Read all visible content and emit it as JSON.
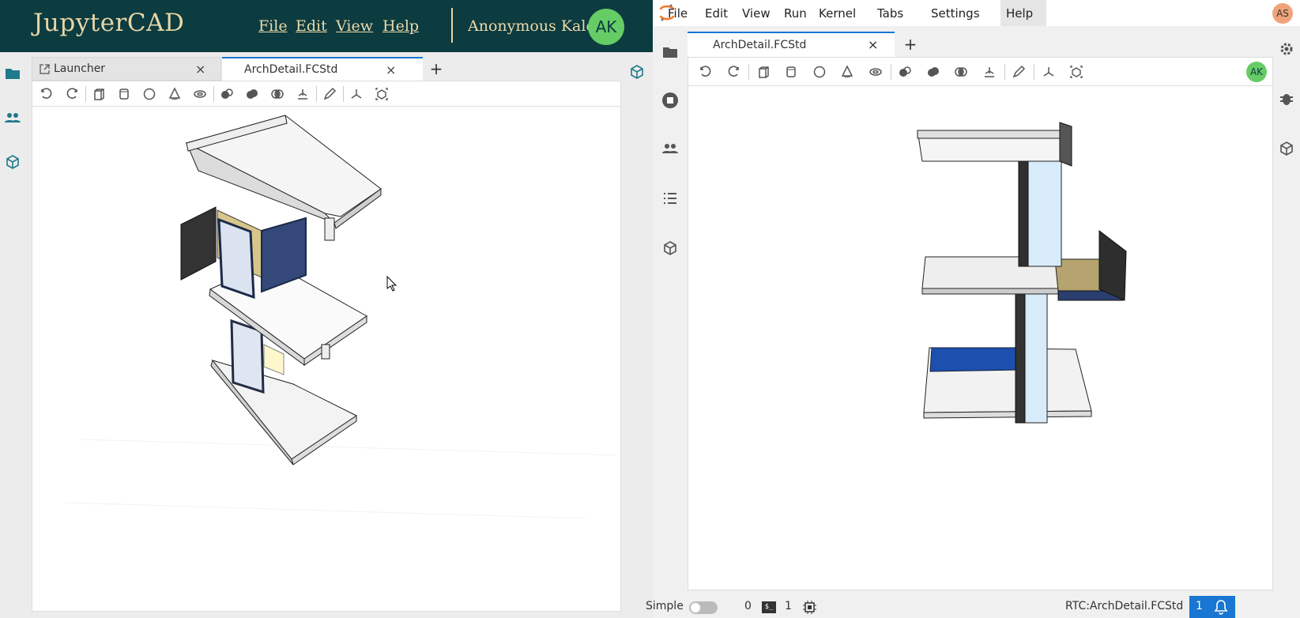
{
  "left_app": {
    "brand": "JupyterCAD",
    "menu": [
      "File",
      "Edit",
      "View",
      "Help"
    ],
    "user_name": "Anonymous Kale",
    "user_initials": "AK",
    "tabs": [
      {
        "label": "Launcher"
      },
      {
        "label": "ArchDetail.FCStd"
      }
    ]
  },
  "right_app": {
    "menu": [
      "File",
      "Edit",
      "View",
      "Run",
      "Kernel",
      "Tabs",
      "Settings",
      "Help"
    ],
    "user_initials": "AS",
    "tab_label": "ArchDetail.FCStd",
    "toolbar_user_initials": "AK",
    "status": {
      "mode_label": "Simple",
      "kernel_count": "0",
      "terminal_count": "1",
      "rtc_label": "RTC:ArchDetail.FCStd",
      "notification_count": "1"
    }
  },
  "toolbar_icons": [
    "undo-icon",
    "redo-icon",
    "box-icon",
    "cylinder-icon",
    "sphere-icon",
    "cone-icon",
    "torus-icon",
    "cut-icon",
    "extrude-icon",
    "union-icon",
    "intersection-icon",
    "sketch-icon",
    "axes-icon",
    "explode-icon"
  ],
  "colors": {
    "header_bg": "#0c3b40",
    "header_text": "#ecd9a8",
    "avatar_green": "#66cc66",
    "accent_blue": "#1976d2",
    "avatar_orange": "#f0a37a"
  }
}
